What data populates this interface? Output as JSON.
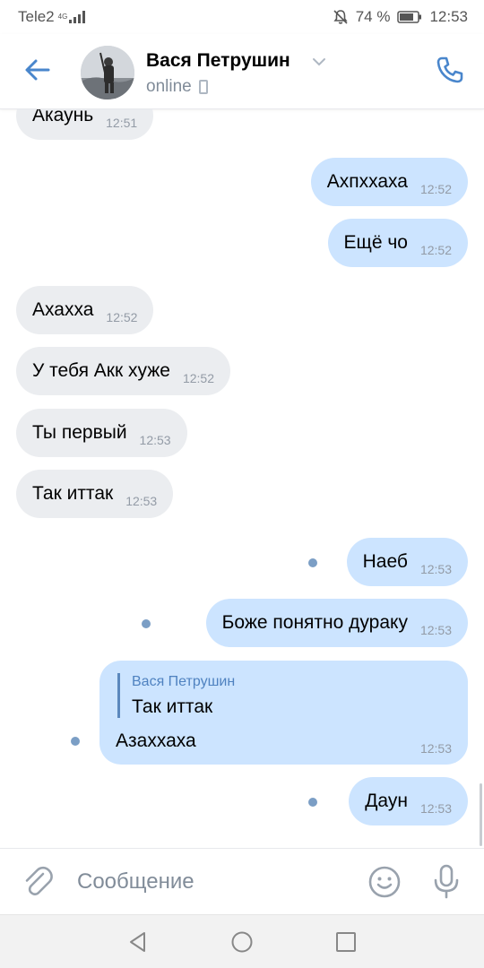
{
  "status_bar": {
    "carrier": "Tele2",
    "network": "4G",
    "battery": "74 %",
    "time": "12:53"
  },
  "header": {
    "contact_name": "Вася Петрушин",
    "status": "online"
  },
  "messages": [
    {
      "direction": "in",
      "text": "Акаунь",
      "time": "12:51"
    },
    {
      "direction": "out",
      "text": "Ахпххаха",
      "time": "12:52"
    },
    {
      "direction": "out",
      "text": "Ещё чо",
      "time": "12:52"
    },
    {
      "direction": "in",
      "text": "Ахахха",
      "time": "12:52"
    },
    {
      "direction": "in",
      "text": "У тебя Акк хуже",
      "time": "12:52"
    },
    {
      "direction": "in",
      "text": "Ты первый",
      "time": "12:53"
    },
    {
      "direction": "in",
      "text": "Так иттак",
      "time": "12:53"
    },
    {
      "direction": "out",
      "text": "Наеб",
      "time": "12:53",
      "unread": true
    },
    {
      "direction": "out",
      "text": "Боже понятно дураку",
      "time": "12:53",
      "unread": true
    },
    {
      "direction": "out",
      "text": "Азаххаха",
      "time": "12:53",
      "unread": true,
      "reply_to": {
        "author": "Вася Петрушин",
        "text": "Так иттак"
      }
    },
    {
      "direction": "out",
      "text": "Даун",
      "time": "12:53",
      "unread": true
    }
  ],
  "composer": {
    "placeholder": "Сообщение"
  },
  "icons": {
    "back": "arrow-left-icon",
    "call": "phone-icon",
    "attach": "paperclip-icon",
    "emoji": "smile-icon",
    "mic": "microphone-icon"
  },
  "colors": {
    "accent": "#4986cc",
    "incoming_bubble": "#ebedf0",
    "outgoing_bubble": "#cce4ff",
    "unread_dot": "#7b9ec5"
  }
}
